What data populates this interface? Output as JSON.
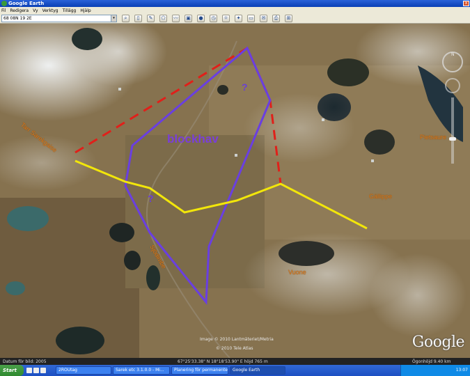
{
  "window": {
    "title": "Google Earth",
    "close_label": "x"
  },
  "menu": [
    "Fil",
    "Redigera",
    "Vy",
    "Verktyg",
    "Tillägg",
    "Hjälp"
  ],
  "search": {
    "value": "68 08N 19 2E",
    "dropdown": "▾"
  },
  "toolbar": {
    "buttons": [
      "search-tool",
      "sidebar-toggle",
      "placemark",
      "polygon",
      "path",
      "image-overlay",
      "record-tour",
      "historical-imagery",
      "sunlight",
      "switch-sky",
      "ruler",
      "email",
      "print",
      "view-in-maps"
    ]
  },
  "map": {
    "labels": {
      "blockhav": "blockhav",
      "q1": "?",
      "q2": "?",
      "left_place": "Tarr Sarekgaise",
      "pietsaure": "Pietsaure",
      "gallippe": "Gällippe",
      "sjodimbe": "Sjödimbe",
      "south_place": "Vuone"
    },
    "attribution_line1": "Image © 2010 Lantmäteriet/Metria",
    "attribution_line2": "© 2010 Tele Atlas",
    "logo": "Google",
    "colors": {
      "red_dashed": "#e0201a",
      "purple": "#6a3fe0",
      "yellow": "#f2e60a",
      "label_orange": "#e07a1a"
    }
  },
  "status": {
    "date": "Datum för bild: 2005",
    "coords": "67°25'33.38\" N   18°18'53.90\" E  höjd  765 m",
    "eye": "Ögonhöjd   9.40 km"
  },
  "taskbar": {
    "start": "Start",
    "tasks": [
      "2ROUtag",
      "Sarek etc 3.1.0.0 - Mi...",
      "Planering för permanente...",
      "Google Earth"
    ],
    "tray_time": "13:07"
  }
}
